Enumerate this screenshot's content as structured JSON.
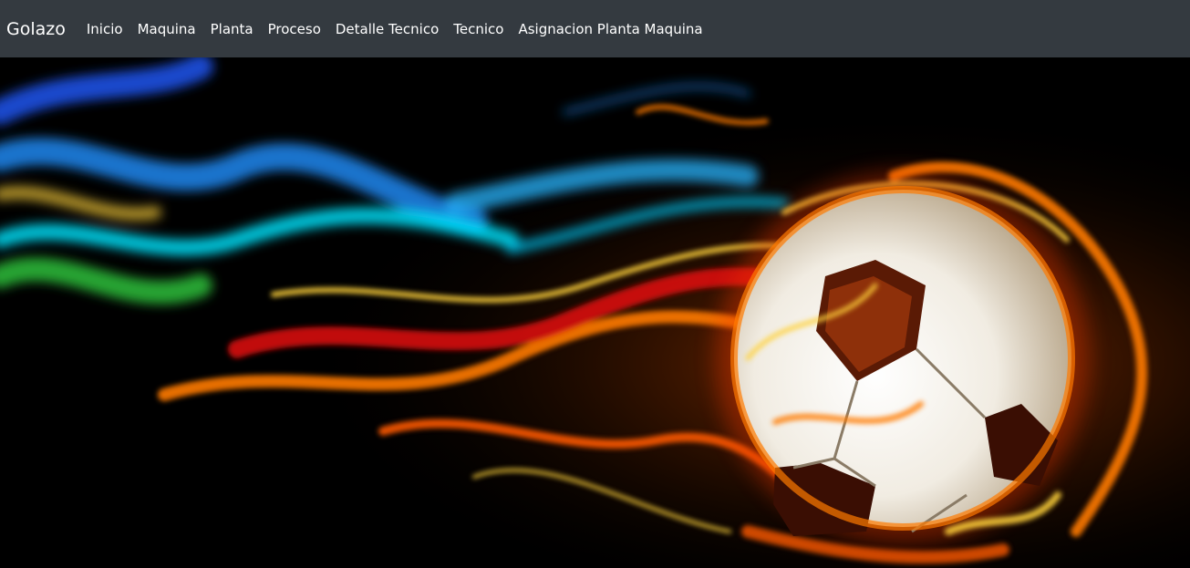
{
  "navbar": {
    "brand": "Golazo",
    "links": [
      {
        "label": "Inicio"
      },
      {
        "label": "Maquina"
      },
      {
        "label": "Planta"
      },
      {
        "label": "Proceso"
      },
      {
        "label": "Detalle Tecnico"
      },
      {
        "label": "Tecnico"
      },
      {
        "label": "Asignacion Planta Maquina"
      }
    ]
  },
  "hero": {
    "image": "flaming-soccer-ball-image",
    "colors": {
      "background": "#000000",
      "flame_blue": "#1e90ff",
      "flame_cyan": "#00e5ff",
      "flame_green": "#2ecc40",
      "flame_orange": "#ff7a00",
      "flame_red": "#e3120b",
      "flame_yellow": "#ffd23a",
      "ball": "#f4f1ea"
    }
  },
  "theme": {
    "navbar_bg": "#343a40",
    "nav_text": "#ffffff"
  }
}
